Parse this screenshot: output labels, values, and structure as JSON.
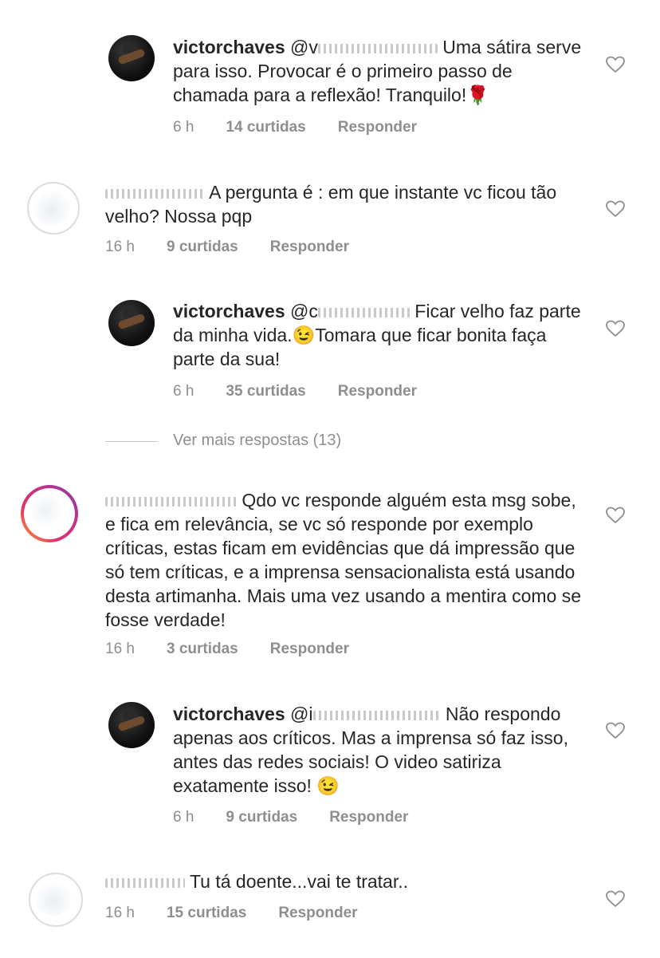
{
  "comments": [
    {
      "username": "victorchaves",
      "mention": "@v",
      "text": "Uma sátira serve para isso. Provocar é o primeiro passo de chamada para a reflexão! Tranquilo!🌹",
      "time": "6 h",
      "likes": "14 curtidas",
      "reply": "Responder"
    },
    {
      "username": "",
      "mention": "",
      "text": "A pergunta é : em que instante vc ficou tão velho? Nossa pqp",
      "time": "16 h",
      "likes": "9 curtidas",
      "reply": "Responder"
    },
    {
      "username": "victorchaves",
      "mention": "@c",
      "text": "Ficar velho faz parte da minha vida.😉Tomara que ficar bonita faça parte da sua!",
      "time": "6 h",
      "likes": "35 curtidas",
      "reply": "Responder"
    },
    {
      "username": "",
      "mention": "",
      "text": "Qdo vc responde alguém esta msg sobe, e fica em relevância, se vc só responde por exemplo críticas, estas ficam em evidências que dá impressão que só tem críticas, e a imprensa sensacionalista está usando desta artimanha. Mais uma vez usando a mentira como se fosse verdade!",
      "time": "16 h",
      "likes": "3 curtidas",
      "reply": "Responder"
    },
    {
      "username": "victorchaves",
      "mention": "@i",
      "text": "Não respondo apenas aos críticos. Mas a imprensa só faz isso, antes das redes sociais! O video satiriza exatamente isso! 😉",
      "time": "6 h",
      "likes": "9 curtidas",
      "reply": "Responder"
    },
    {
      "username": "",
      "mention": "",
      "text": "Tu tá doente...vai te tratar..",
      "time": "16 h",
      "likes": "15 curtidas",
      "reply": "Responder"
    }
  ],
  "more_replies": "Ver mais respostas (13)",
  "icons": {
    "like": "heart-outline-icon"
  },
  "colors": {
    "text": "#262626",
    "meta": "#8e8e8e",
    "divider": "#c7c7c7"
  }
}
